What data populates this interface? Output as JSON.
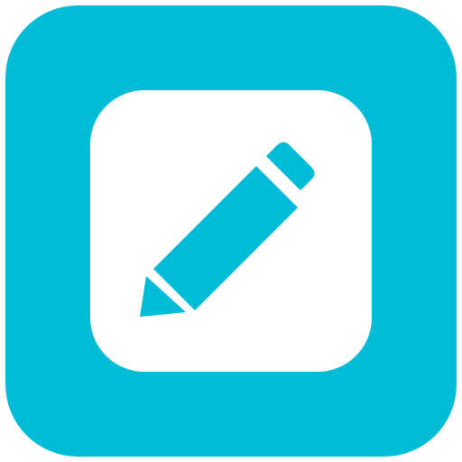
{
  "icon": {
    "name": "edit-pencil-icon",
    "background_color": "#00BCD6",
    "tile_color": "#FFFFFF",
    "glyph_color": "#00BCD6"
  }
}
